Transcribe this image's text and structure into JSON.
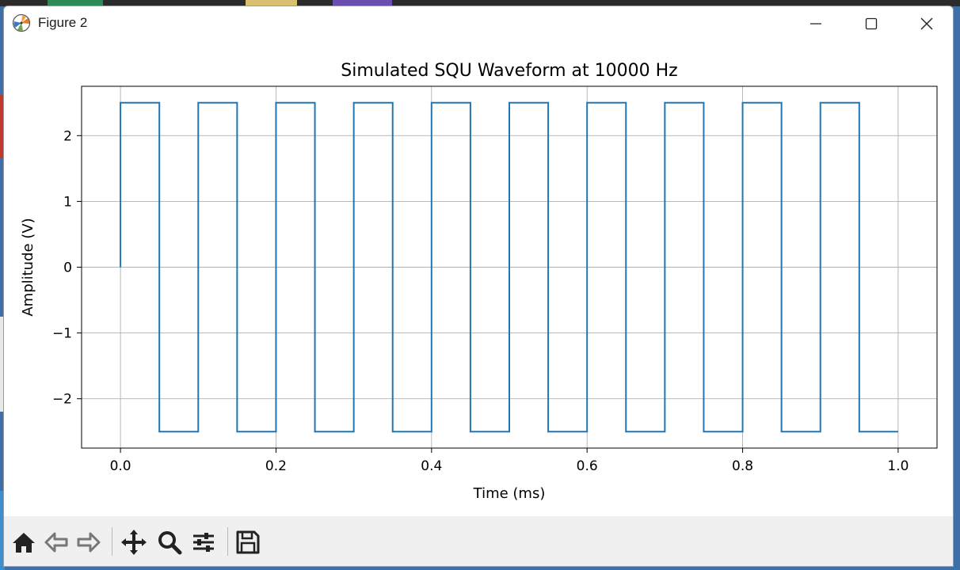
{
  "window": {
    "title": "Figure 2"
  },
  "colors": {
    "line": "#1f77b4",
    "grid": "#b0b0b0",
    "icon": "#222222"
  },
  "toolbar": {
    "buttons": [
      {
        "name": "home-icon"
      },
      {
        "name": "back-arrow-icon"
      },
      {
        "name": "forward-arrow-icon"
      },
      {
        "name": "pan-icon"
      },
      {
        "name": "zoom-icon"
      },
      {
        "name": "configure-subplots-icon"
      },
      {
        "name": "save-icon"
      }
    ]
  },
  "chart_data": {
    "type": "line",
    "title": "Simulated SQU Waveform at 10000 Hz",
    "xlabel": "Time (ms)",
    "ylabel": "Amplitude (V)",
    "xlim": [
      -0.05,
      1.05
    ],
    "ylim": [
      -2.75,
      2.75
    ],
    "xticks": [
      0.0,
      0.2,
      0.4,
      0.6,
      0.8,
      1.0
    ],
    "xtick_labels": [
      "0.0",
      "0.2",
      "0.4",
      "0.6",
      "0.8",
      "1.0"
    ],
    "yticks": [
      -2,
      -1,
      0,
      1,
      2
    ],
    "ytick_labels": [
      "−2",
      "−1",
      "0",
      "1",
      "2"
    ],
    "grid": true,
    "series": [
      {
        "x": [
          0.0,
          0.0,
          0.05,
          0.05,
          0.1,
          0.1,
          0.15,
          0.15,
          0.2,
          0.2,
          0.25,
          0.25,
          0.3,
          0.3,
          0.35,
          0.35,
          0.4,
          0.4,
          0.45,
          0.45,
          0.5,
          0.5,
          0.55,
          0.55,
          0.6,
          0.6,
          0.65,
          0.65,
          0.7,
          0.7,
          0.75,
          0.75,
          0.8,
          0.8,
          0.85,
          0.85,
          0.9,
          0.9,
          0.95,
          0.95,
          1.0
        ],
        "y": [
          0.0,
          2.5,
          2.5,
          -2.5,
          -2.5,
          2.5,
          2.5,
          -2.5,
          -2.5,
          2.5,
          2.5,
          -2.5,
          -2.5,
          2.5,
          2.5,
          -2.5,
          -2.5,
          2.5,
          2.5,
          -2.5,
          -2.5,
          2.5,
          2.5,
          -2.5,
          -2.5,
          2.5,
          2.5,
          -2.5,
          -2.5,
          2.5,
          2.5,
          -2.5,
          -2.5,
          2.5,
          2.5,
          -2.5,
          -2.5,
          2.5,
          2.5,
          -2.5,
          -2.5
        ]
      }
    ]
  }
}
